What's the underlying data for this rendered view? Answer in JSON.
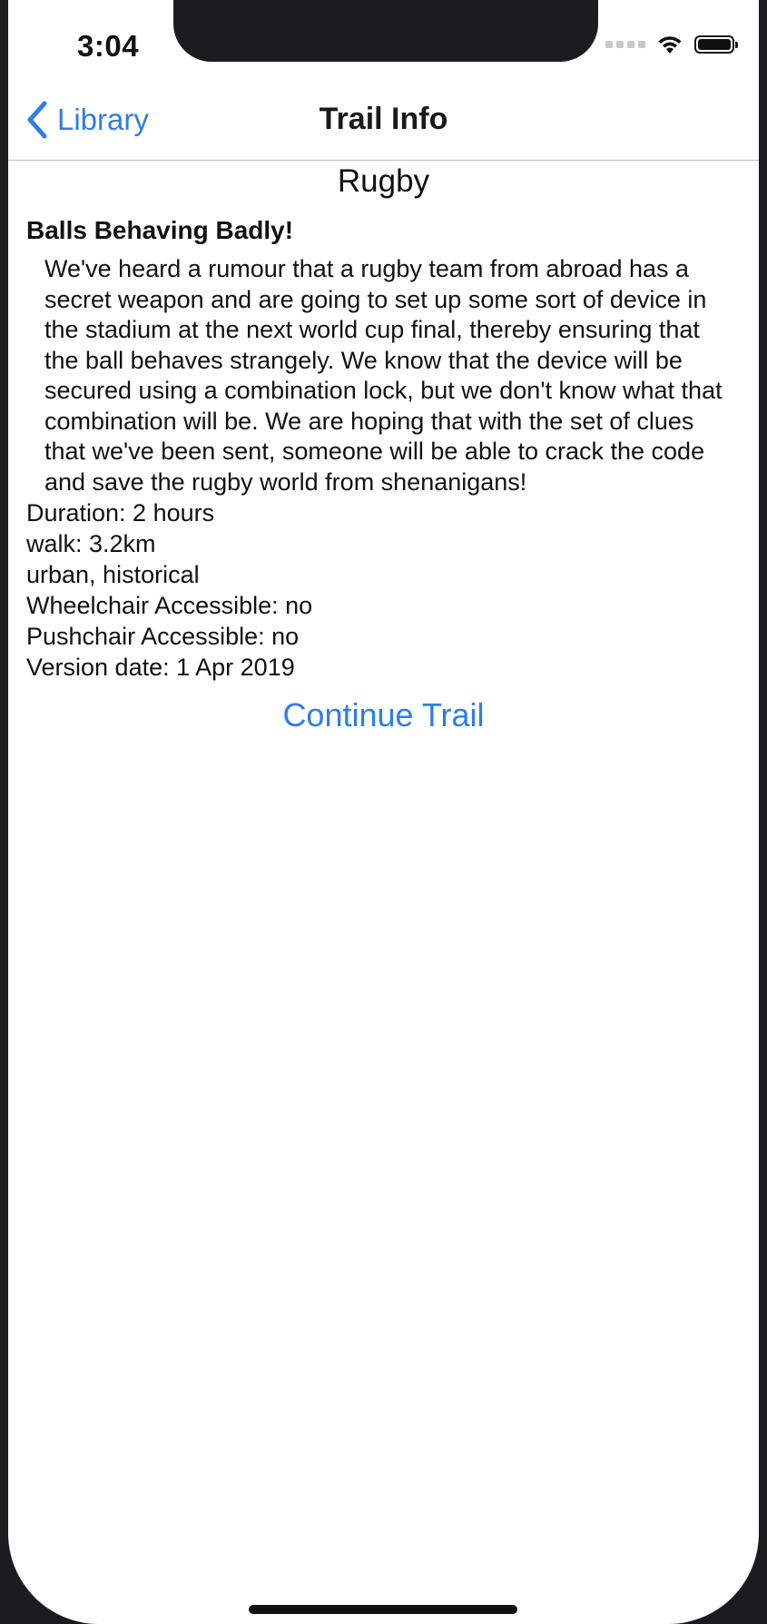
{
  "status_bar": {
    "time": "3:04"
  },
  "nav": {
    "back_label": "Library",
    "title": "Trail Info"
  },
  "trail": {
    "name": "Rugby",
    "heading": "Balls Behaving Badly!",
    "description": "We've heard a rumour that a rugby team from abroad has a secret weapon and are going to set up some sort of device in the stadium at the next world cup final, thereby ensuring that the ball behaves strangely. We know that the device will be secured using a combination lock, but we don't know what that combination will be. We are hoping that with the set of clues that we've been sent, someone will be able to crack the code and save the rugby world from shenanigans!",
    "duration": "Duration: 2 hours",
    "walk": "walk: 3.2km",
    "tags": "urban, historical",
    "wheelchair": "Wheelchair Accessible: no",
    "pushchair": "Pushchair Accessible: no",
    "version_date": "Version date: 1 Apr 2019"
  },
  "actions": {
    "continue_label": "Continue Trail"
  },
  "colors": {
    "accent": "#2f7de6",
    "background": "#ffffff",
    "frame": "#1c1c1e"
  }
}
